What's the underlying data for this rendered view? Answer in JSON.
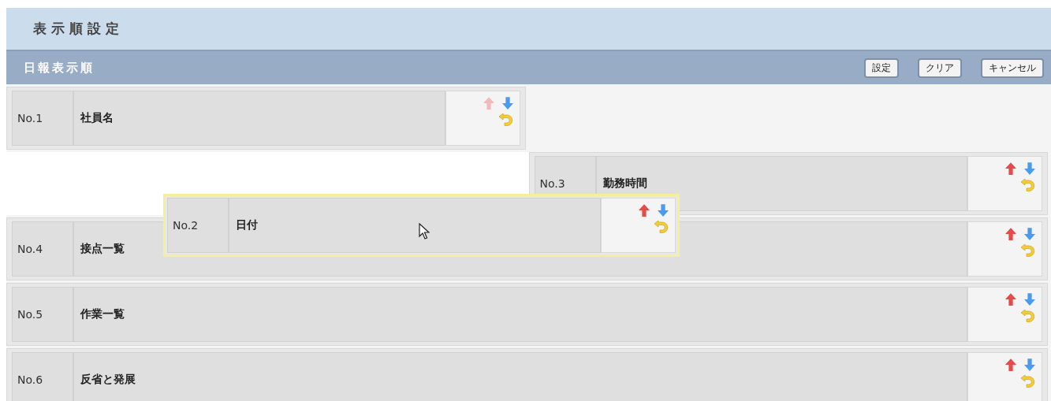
{
  "page_title": "表示順設定",
  "section": {
    "title": "日報表示順",
    "buttons": [
      "設定",
      "クリア",
      "キャンセル"
    ]
  },
  "slots": [
    {
      "kind": "half-item",
      "no": "No.1",
      "name": "社員名",
      "up_disabled": true
    },
    {
      "kind": "drop-slot"
    },
    {
      "kind": "half-item",
      "no": "No.3",
      "name": "勤務時間",
      "up_disabled": false
    },
    {
      "kind": "full-item",
      "no": "No.4",
      "name": "接点一覧",
      "up_disabled": false
    },
    {
      "kind": "full-item",
      "no": "No.5",
      "name": "作業一覧",
      "up_disabled": false
    },
    {
      "kind": "full-item",
      "no": "No.6",
      "name": "反省と発展",
      "up_disabled": false
    }
  ],
  "dragged_item": {
    "no": "No.2",
    "name": "日付",
    "up_disabled": false
  }
}
